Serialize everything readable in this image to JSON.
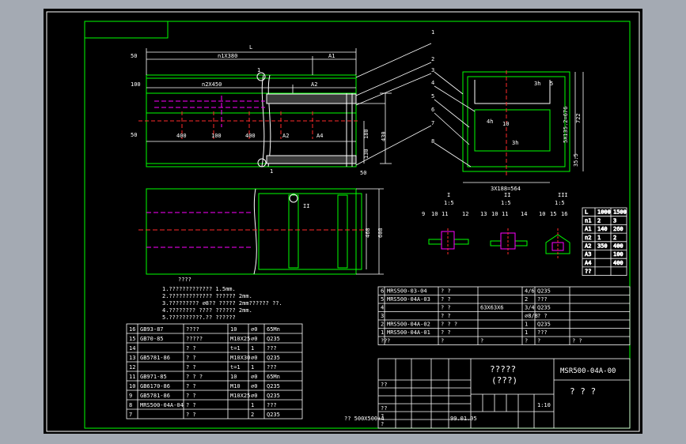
{
  "colors": {
    "background": "#a4aab3",
    "canvas": "#000000",
    "green": "#00ff00",
    "white": "#ffffff",
    "magenta": "#ff00ff",
    "red": "#ff2a2a",
    "cyan": "#00ffff",
    "yellow": "#ffff00"
  },
  "front_view": {
    "dims": {
      "L": "L",
      "n1": "n1X380",
      "A1": "A1",
      "n2": "n2X450",
      "A2": "A2",
      "d50a": "50",
      "d100": "100",
      "d50b": "50",
      "d400a": "400",
      "d100b": "100",
      "d400b": "400",
      "A2b": "A2",
      "A4": "A4",
      "d50c": "50",
      "d180": "180",
      "d430": "430",
      "d130": "130"
    },
    "balloon1": "1",
    "balloon1b": "1"
  },
  "side_view": {
    "dims": {
      "d135": "5X135.2=676",
      "d722": "722",
      "d388": "3X188=564",
      "d35": "35.5"
    },
    "items": [
      "3h",
      "5",
      "4h",
      "10",
      "3h"
    ]
  },
  "bottom_view": {
    "balloon": "II",
    "d468": "468",
    "d608": "608"
  },
  "callouts": [
    "1",
    "2",
    "3",
    "4",
    "5",
    "6",
    "7",
    "8"
  ],
  "details": [
    {
      "label": "I",
      "scale": "1:5",
      "parts": [
        "9",
        "10",
        "11",
        "12"
      ]
    },
    {
      "label": "II",
      "scale": "1:5",
      "parts": [
        "13",
        "10",
        "11",
        "14"
      ]
    },
    {
      "label": "III",
      "scale": "1:5",
      "parts": [
        "10",
        "15",
        "16"
      ]
    }
  ],
  "notes": {
    "title": "????",
    "lines": [
      "1.????????????? 1.5mm.",
      "2.????????????? ?????? 2mm.",
      "3.????????? ∅8?? ????? 2mm??????  ??.",
      "4.???????? ???? ?????? 2mm.",
      "5.??????????.?? ??????"
    ]
  },
  "dim_table": {
    "rows": [
      [
        "L",
        "1000",
        "1500"
      ],
      [
        "n1",
        "2",
        "3"
      ],
      [
        "A1",
        "140",
        "260"
      ],
      [
        "n2",
        "1",
        "2"
      ],
      [
        "A2",
        "350",
        "400"
      ],
      [
        "A3",
        "",
        "100"
      ],
      [
        "A4",
        "",
        "400"
      ],
      [
        "??",
        "",
        ""
      ]
    ]
  },
  "bom_upper": [
    [
      "6",
      "MRS500-03-04",
      "?  ?",
      "",
      "4/6",
      "Q235",
      ""
    ],
    [
      "5",
      "MRS500-04A-03",
      "?  ?",
      "",
      "2",
      "???",
      ""
    ],
    [
      "4",
      "",
      "?  ?",
      "63X63X6",
      "3/4",
      "Q235",
      ""
    ],
    [
      "3",
      "",
      "?  ?",
      "",
      "∅8/8",
      "?  ?",
      ""
    ],
    [
      "2",
      "MRS500-04A-02",
      "?  ?  ?",
      "",
      "1",
      "Q235",
      ""
    ],
    [
      "1",
      "MRS500-04A-01",
      "?  ?",
      "",
      "1",
      "???",
      ""
    ],
    [
      "??",
      "?",
      "?",
      "?",
      "?",
      "?",
      "?  ?"
    ]
  ],
  "bom_lower": [
    [
      "16",
      "GB93-87",
      "????",
      "10",
      "∅0",
      "65Mn"
    ],
    [
      "15",
      "GB70-85",
      "?????",
      "M10X25",
      "∅0",
      "Q235"
    ],
    [
      "14",
      "",
      "?  ?",
      "t=1",
      "1",
      "???"
    ],
    [
      "13",
      "GB5781-86",
      "?  ?",
      "M10X30",
      "∅0",
      "Q235"
    ],
    [
      "12",
      "",
      "?  ?",
      "t=1",
      "1",
      "???"
    ],
    [
      "11",
      "GB971-85",
      "?  ?  ?",
      "10",
      "∅0",
      "65Mn"
    ],
    [
      "10",
      "GB6170-86",
      "?  ?",
      "M10",
      "∅0",
      "Q235"
    ],
    [
      "9",
      "GB5781-86",
      "?  ?",
      "M10X25",
      "∅0",
      "Q235"
    ],
    [
      "8",
      "MRS500-04A-04",
      "?  ?",
      "",
      "1",
      "???"
    ],
    [
      "7",
      "",
      "?  ?",
      "",
      "2",
      "Q235"
    ]
  ],
  "title_block": {
    "name": "?????",
    "subname": "(???)",
    "drawing_no": "MSR500-04A-00",
    "company": "?  ?  ?",
    "scale": "1:10",
    "date": "99.01.05",
    "size": "?? 500X500+4",
    "sign": [
      "??",
      "??",
      "?",
      "?"
    ]
  }
}
